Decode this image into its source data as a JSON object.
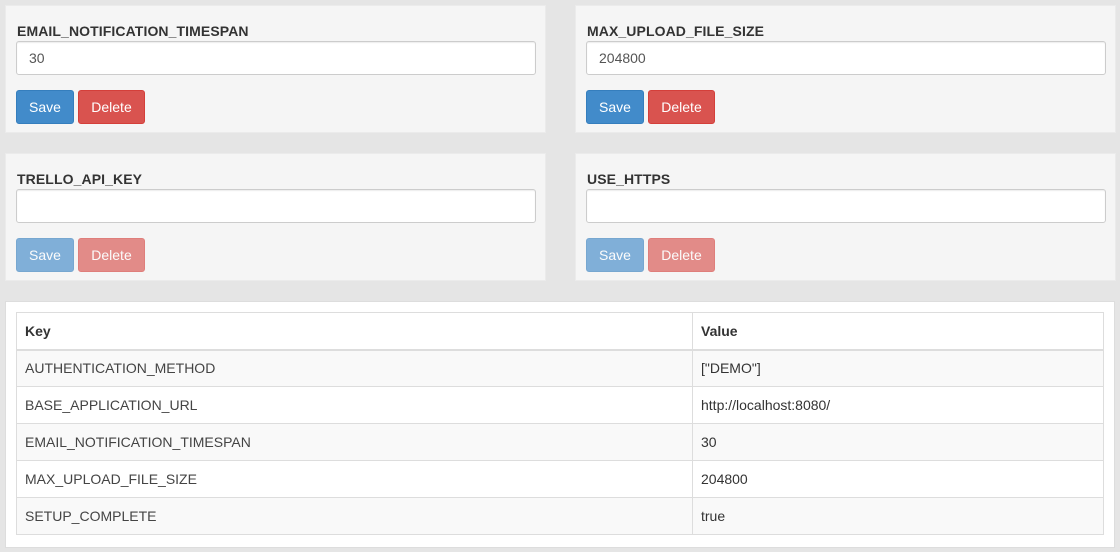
{
  "settings": [
    {
      "key": "EMAIL_NOTIFICATION_TIMESPAN",
      "value": "30",
      "save_label": "Save",
      "delete_label": "Delete",
      "enabled": true
    },
    {
      "key": "MAX_UPLOAD_FILE_SIZE",
      "value": "204800",
      "save_label": "Save",
      "delete_label": "Delete",
      "enabled": true
    },
    {
      "key": "TRELLO_API_KEY",
      "value": "",
      "save_label": "Save",
      "delete_label": "Delete",
      "enabled": false
    },
    {
      "key": "USE_HTTPS",
      "value": "",
      "save_label": "Save",
      "delete_label": "Delete",
      "enabled": false
    }
  ],
  "table": {
    "headers": {
      "key": "Key",
      "value": "Value"
    },
    "rows": [
      {
        "key": "AUTHENTICATION_METHOD",
        "value": "[\"DEMO\"]"
      },
      {
        "key": "BASE_APPLICATION_URL",
        "value": "http://localhost:8080/"
      },
      {
        "key": "EMAIL_NOTIFICATION_TIMESPAN",
        "value": "30"
      },
      {
        "key": "MAX_UPLOAD_FILE_SIZE",
        "value": "204800"
      },
      {
        "key": "SETUP_COMPLETE",
        "value": "true"
      }
    ]
  },
  "colors": {
    "save": "#428bca",
    "delete": "#d9534f",
    "panel": "#f5f5f5",
    "background": "#e5e5e5"
  }
}
